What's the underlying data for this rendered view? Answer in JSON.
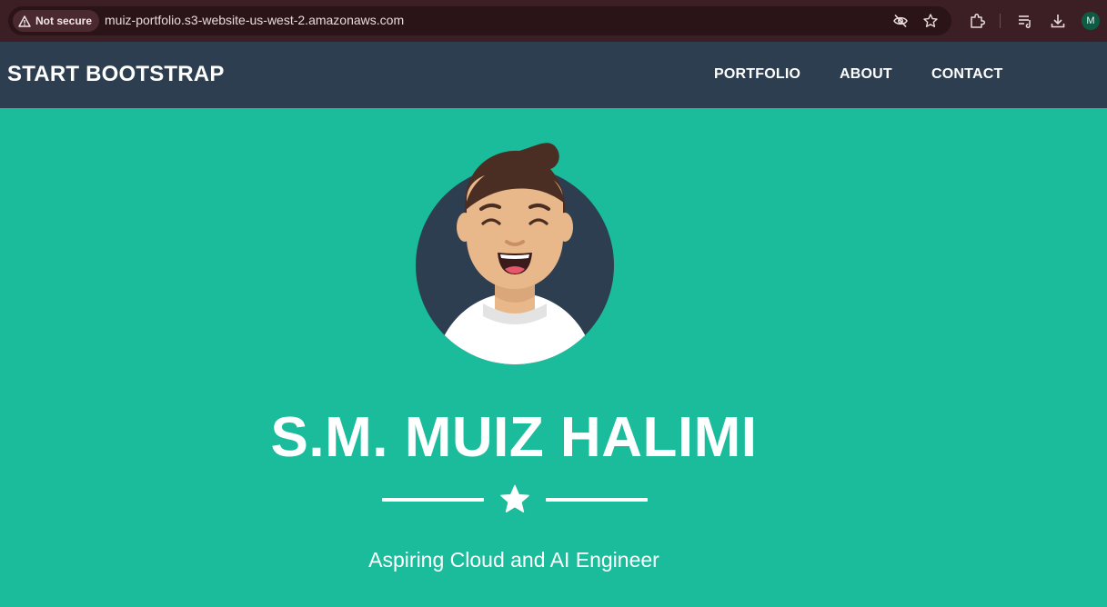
{
  "browser": {
    "security_label": "Not secure",
    "url": "muiz-portfolio.s3-website-us-west-2.amazonaws.com",
    "profile_initial": "M",
    "icons": [
      "warning-icon",
      "eye-off-icon",
      "bookmark-star-icon",
      "extensions-icon",
      "reading-list-icon",
      "download-icon"
    ],
    "colors": {
      "chrome_bg": "#3c1f24",
      "omnibox_bg": "#2a1418"
    }
  },
  "navbar": {
    "brand": "START BOOTSTRAP",
    "links": [
      "PORTFOLIO",
      "ABOUT",
      "CONTACT"
    ],
    "colors": {
      "bg": "#2c3e50",
      "text": "#ffffff"
    }
  },
  "hero": {
    "name": "S.M. MUIZ HALIMI",
    "subtitle": "Aspiring Cloud and AI Engineer",
    "divider_icon": "star-icon",
    "avatar_icon": "avatar-illustration",
    "colors": {
      "bg": "#1abc9c",
      "text": "#ffffff"
    }
  }
}
